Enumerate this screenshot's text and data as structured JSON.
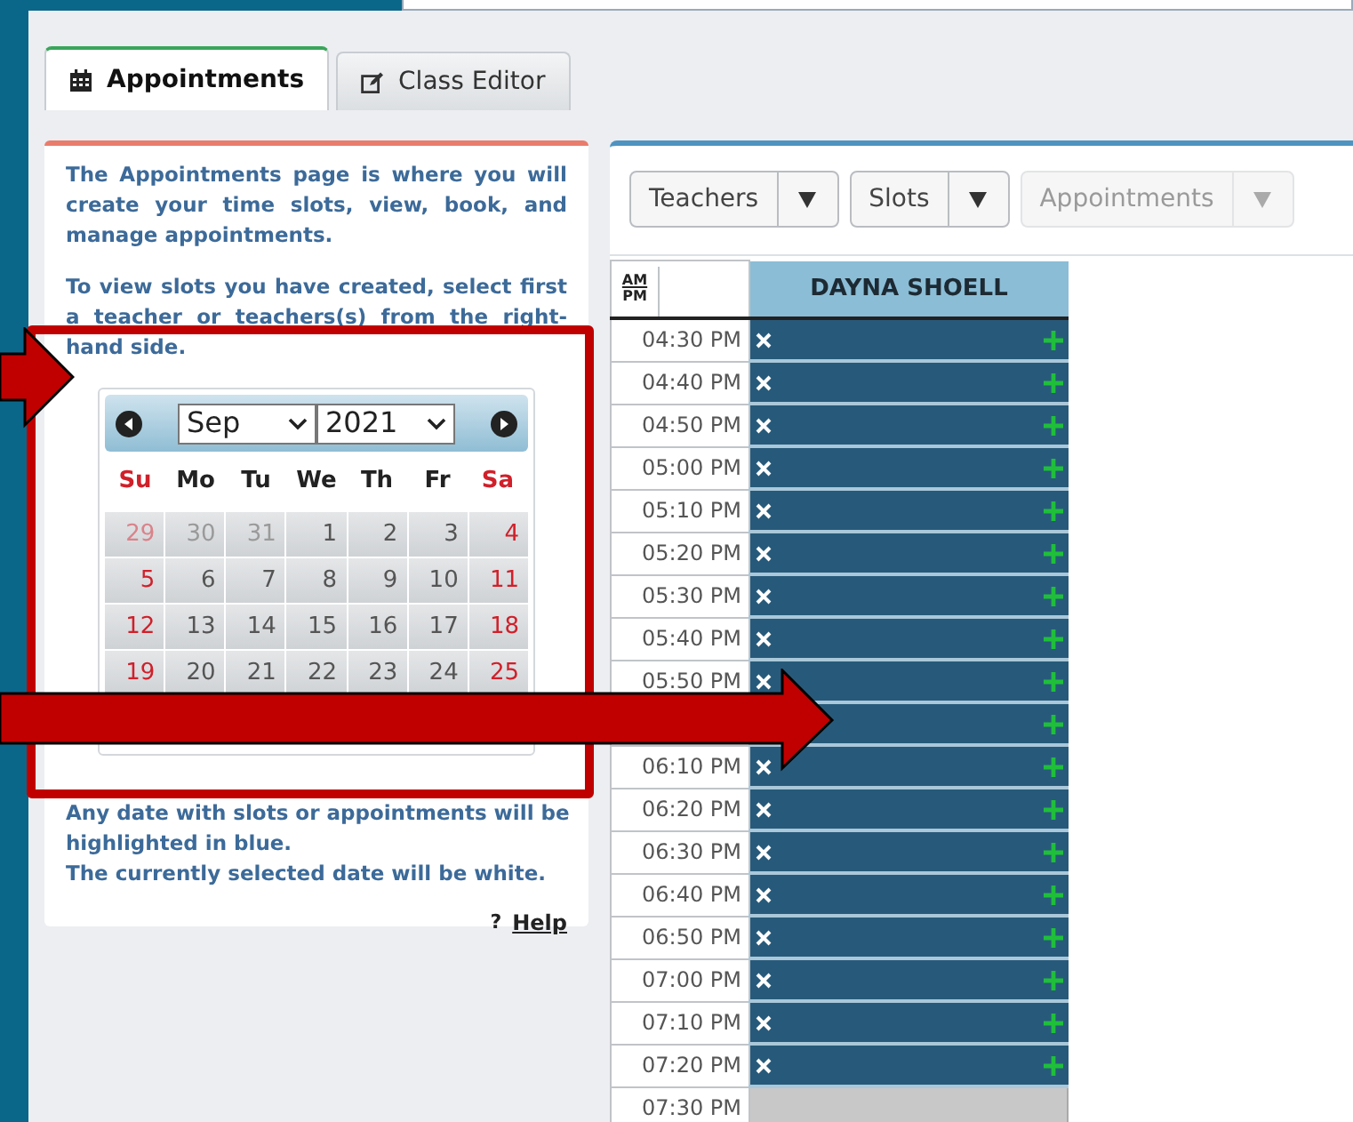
{
  "tabs": [
    {
      "label": "Appointments",
      "selected": true
    },
    {
      "label": "Class Editor",
      "selected": false
    }
  ],
  "info": {
    "paragraphs": [
      "The Appointments page is where you will create your time slots, view, book, and manage appointments.",
      "To view slots you have created, select first a teacher or teachers(s) from the right-hand side."
    ],
    "notes": [
      "Any date with slots or appointments will be",
      "highlighted in blue.",
      "The currently selected date will be white."
    ],
    "help": {
      "icon": "?",
      "label": "Help"
    }
  },
  "calendar": {
    "month": "Sep",
    "year": "2021",
    "weekdays": [
      {
        "label": "Su",
        "weekend": true
      },
      {
        "label": "Mo",
        "weekend": false
      },
      {
        "label": "Tu",
        "weekend": false
      },
      {
        "label": "We",
        "weekend": false
      },
      {
        "label": "Th",
        "weekend": false
      },
      {
        "label": "Fr",
        "weekend": false
      },
      {
        "label": "Sa",
        "weekend": true
      }
    ],
    "weeks": [
      [
        {
          "day": "29",
          "weekend": true,
          "other_month": true
        },
        {
          "day": "30",
          "weekend": false,
          "other_month": true
        },
        {
          "day": "31",
          "weekend": false,
          "other_month": true
        },
        {
          "day": "1",
          "weekend": false,
          "other_month": false
        },
        {
          "day": "2",
          "weekend": false,
          "other_month": false
        },
        {
          "day": "3",
          "weekend": false,
          "other_month": false
        },
        {
          "day": "4",
          "weekend": true,
          "other_month": false
        }
      ],
      [
        {
          "day": "5",
          "weekend": true,
          "other_month": false
        },
        {
          "day": "6",
          "weekend": false,
          "other_month": false
        },
        {
          "day": "7",
          "weekend": false,
          "other_month": false
        },
        {
          "day": "8",
          "weekend": false,
          "other_month": false
        },
        {
          "day": "9",
          "weekend": false,
          "other_month": false
        },
        {
          "day": "10",
          "weekend": false,
          "other_month": false
        },
        {
          "day": "11",
          "weekend": true,
          "other_month": false
        }
      ],
      [
        {
          "day": "12",
          "weekend": true,
          "other_month": false
        },
        {
          "day": "13",
          "weekend": false,
          "other_month": false
        },
        {
          "day": "14",
          "weekend": false,
          "other_month": false
        },
        {
          "day": "15",
          "weekend": false,
          "other_month": false
        },
        {
          "day": "16",
          "weekend": false,
          "other_month": false
        },
        {
          "day": "17",
          "weekend": false,
          "other_month": false
        },
        {
          "day": "18",
          "weekend": true,
          "other_month": false
        }
      ],
      [
        {
          "day": "19",
          "weekend": true,
          "other_month": false
        },
        {
          "day": "20",
          "weekend": false,
          "other_month": false
        },
        {
          "day": "21",
          "weekend": false,
          "other_month": false
        },
        {
          "day": "22",
          "weekend": false,
          "other_month": false
        },
        {
          "day": "23",
          "weekend": false,
          "other_month": false
        },
        {
          "day": "24",
          "weekend": false,
          "other_month": false
        },
        {
          "day": "25",
          "weekend": true,
          "other_month": false
        }
      ]
    ]
  },
  "toolbar": [
    {
      "label": "Teachers",
      "disabled": false
    },
    {
      "label": "Slots",
      "disabled": false
    },
    {
      "label": "Appointments",
      "disabled": true
    }
  ],
  "schedule": {
    "ampm": [
      "AM",
      "PM"
    ],
    "teacher": "DAYNA SHOELL",
    "rows": [
      {
        "time": "04:30 PM",
        "kind": "slot",
        "delete": true
      },
      {
        "time": "04:40 PM",
        "kind": "slot",
        "delete": true
      },
      {
        "time": "04:50 PM",
        "kind": "slot",
        "delete": true
      },
      {
        "time": "05:00 PM",
        "kind": "slot",
        "delete": true
      },
      {
        "time": "05:10 PM",
        "kind": "slot",
        "delete": true
      },
      {
        "time": "05:20 PM",
        "kind": "slot",
        "delete": true
      },
      {
        "time": "05:30 PM",
        "kind": "slot",
        "delete": true
      },
      {
        "time": "05:40 PM",
        "kind": "slot",
        "delete": true
      },
      {
        "time": "05:50 PM",
        "kind": "slot",
        "delete": true
      },
      {
        "kind": "slot"
      },
      {
        "time": "06:10 PM",
        "kind": "slot",
        "delete": true
      },
      {
        "time": "06:20 PM",
        "kind": "slot",
        "delete": true
      },
      {
        "time": "06:30 PM",
        "kind": "slot",
        "delete": true
      },
      {
        "time": "06:40 PM",
        "kind": "slot",
        "delete": true
      },
      {
        "time": "06:50 PM",
        "kind": "slot",
        "delete": true
      },
      {
        "time": "07:00 PM",
        "kind": "slot",
        "delete": true
      },
      {
        "time": "07:10 PM",
        "kind": "slot",
        "delete": true
      },
      {
        "time": "07:20 PM",
        "kind": "slot",
        "delete": true
      },
      {
        "time": "07:30 PM",
        "kind": "empty"
      }
    ]
  }
}
